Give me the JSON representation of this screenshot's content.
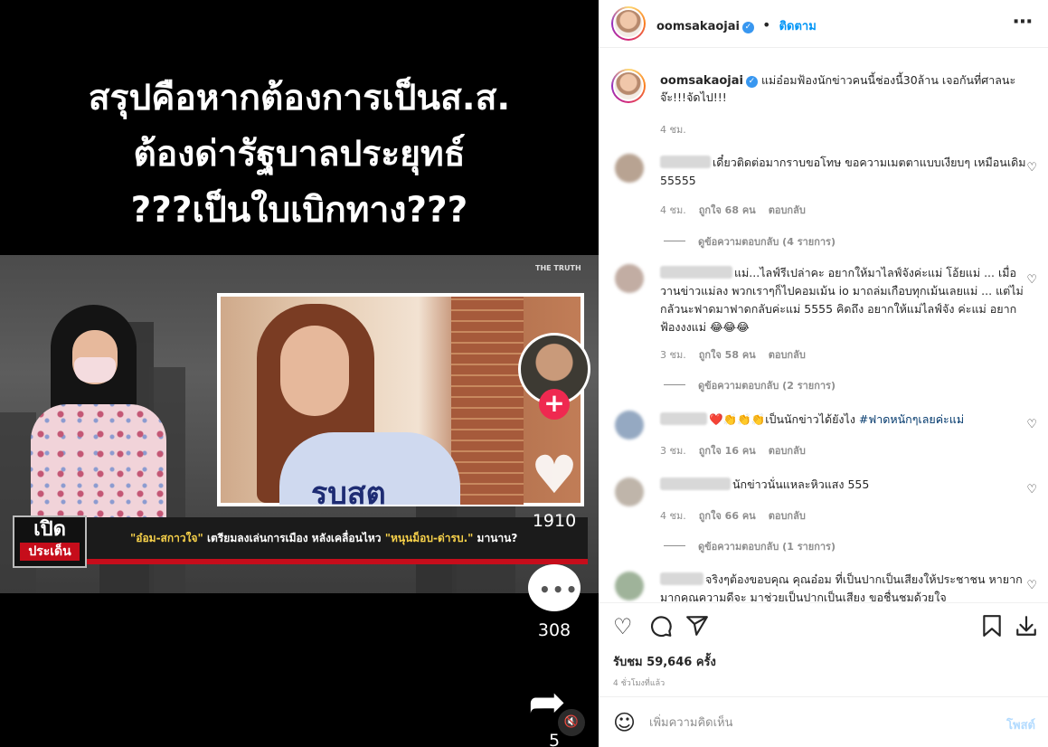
{
  "media": {
    "headline": [
      "สรุปคือหากต้องการเป็นส.ส.",
      "ต้องด่ารัฐบาลประยุทธ์",
      "???เป็นใบเบิกทาง???"
    ],
    "brand": "THE TRUTH",
    "logo_top": "เปิด",
    "logo_bottom": "ประเด็น",
    "ticker_yellow": "\"อ๋อม-สกาวใจ\"",
    "ticker_white": " เตรียมลงเล่นการเมือง หลังเคลื่อนไหว ",
    "ticker_yellow2": "\"หนุนม็อบ-ด่ารบ.\"",
    "ticker_end": " มานาน?",
    "shirt_text": "รบสต",
    "like_count": "1910",
    "comment_count": "308",
    "share_count": "5"
  },
  "header": {
    "username": "oomsakaojai",
    "separator": "•",
    "follow_label": "ติดตาม",
    "more_icon": "⋯"
  },
  "caption": {
    "username": "oomsakaojai",
    "text": "แม่อ๋อมฟ้องนักข่าวคนนี้ช่องนี้30ล้าน เจอกันที่ศาลนะ จ๊ะ!!!จัดไป!!!",
    "time": "4 ชม."
  },
  "comments": [
    {
      "text": "เดี๋ยวติดต่อมากราบขอโทษ ขอความเมตตาแบบเงียบๆ เหมือนเดิม 55555",
      "time": "4 ชม.",
      "likes": "ถูกใจ 68 คน",
      "reply": "ตอบกลับ",
      "view_replies": "ดูข้อความตอบกลับ (4 รายการ)"
    },
    {
      "text": "แม่...ไลฟ์รีเปล่าคะ อยากให้มาไลฟ์จังค่ะแม่ โอ้ยแม่ ... เมื่อวานข่าวแม่ลง พวกเราๆก็ไปคอมเม้น io มาถล่มเกือบทุกเม้นเลยแม่ ... แต่ไม่กลัวนะฟาดมาฟาดกลับค่ะแม่ 5555 คิดถึง อยากให้แม่ไลฟ์จัง ค่ะแม่ อยากฟ้องงงแม่ 😂😂😂",
      "time": "3 ชม.",
      "likes": "ถูกใจ 58 คน",
      "reply": "ตอบกลับ",
      "view_replies": "ดูข้อความตอบกลับ (2 รายการ)"
    },
    {
      "text": "❤️👏👏👏เป็นนักข่าวได้ยังไง ",
      "tag": "#ฟาดหนักๆเลยค่ะแม่",
      "time": "3 ชม.",
      "likes": "ถูกใจ 16 คน",
      "reply": "ตอบกลับ"
    },
    {
      "text": "นักข่าวนั่นแหละหิวแสง 555",
      "time": "4 ชม.",
      "likes": "ถูกใจ 66 คน",
      "reply": "ตอบกลับ",
      "view_replies": "ดูข้อความตอบกลับ (1 รายการ)"
    },
    {
      "text": "จริงๆต้องขอบคุณ คุณอ๋อม ที่เป็นปากเป็นเสียงให้ประชาชน หายากมากคุณความดีจะ มาช่วยเป็นปากเป็นเสียง ขอชื่นชมด้วยใจ"
    }
  ],
  "actions": {
    "likes_text": "รับชม 59,646 ครั้ง",
    "time_ago": "4 ชั่วโมงที่แล้ว"
  },
  "add_comment": {
    "placeholder": "เพิ่มความคิดเห็น",
    "post_label": "โพสต์"
  },
  "colors": {
    "accent": "#0095f6",
    "verified": "#3897f0",
    "muted": "#8e8e8e",
    "plus": "#ef2950"
  }
}
